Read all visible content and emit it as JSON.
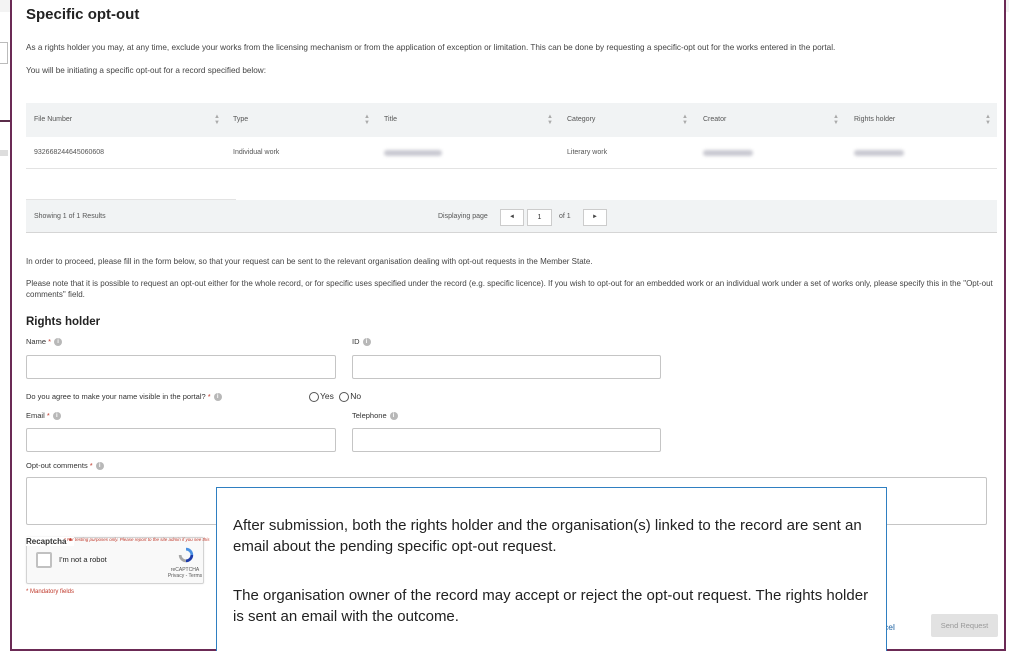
{
  "modal": {
    "title": "Specific opt-out",
    "intro": "As a rights holder you may, at any time, exclude your works from the licensing mechanism or from the application of exception or limitation. This can be done by requesting a specific-opt out for the works entered in the portal.",
    "initiating": "You will be initiating a specific opt-out for a record specified below:"
  },
  "table": {
    "headers": [
      "File Number",
      "Type",
      "Title",
      "Category",
      "Creator",
      "Rights holder"
    ],
    "row": {
      "file_number": "932668244645060608",
      "type": "Individual work",
      "category": "Literary work"
    },
    "footer": {
      "showing": "Showing 1 of 1 Results",
      "displaying": "Displaying page",
      "page": "1",
      "of": "of 1",
      "prev_icon": "◄",
      "next_icon": "►"
    }
  },
  "form": {
    "proceed_text": "In order to proceed, please fill in the form below, so that your request can be sent to the relevant organisation dealing with opt-out requests in the Member State.",
    "note_text": "Please note that it is possible to request an opt-out either for the whole record, or for specific uses specified under the record (e.g. specific licence). If you wish to opt-out for an embedded work or an individual work under a set of works only, please specify this in the \"Opt-out comments\" field.",
    "section_title": "Rights holder",
    "name_label": "Name",
    "id_label": "ID",
    "visible_label": "Do you agree to make your name visible in the portal?",
    "yes": "Yes",
    "no": "No",
    "email_label": "Email",
    "telephone_label": "Telephone",
    "comments_label": "Opt-out comments",
    "required_mark": "*",
    "info_glyph": "i",
    "recaptcha_label": "Recaptcha",
    "recaptcha_note": "* For testing purposes only. Please report to the site admin if you see this",
    "recaptcha_checkbox": "I'm not a robot",
    "recaptcha_brand": "reCAPTCHA",
    "recaptcha_terms": "Privacy - Terms",
    "mandatory": "* Mandatory fields",
    "cancel": "cel",
    "send": "Send Request"
  },
  "callout": {
    "p1": "After submission, both the rights holder and the organisation(s) linked to the record are sent an email about the pending specific opt-out request.",
    "p2": "The organisation owner of the record may accept or reject the opt-out request. The rights holder is sent an email with the outcome."
  },
  "colors": {
    "modal_border": "#6b2a55",
    "callout_border": "#2f7fc1",
    "required": "#c0392b",
    "link": "#1a5fa0"
  }
}
